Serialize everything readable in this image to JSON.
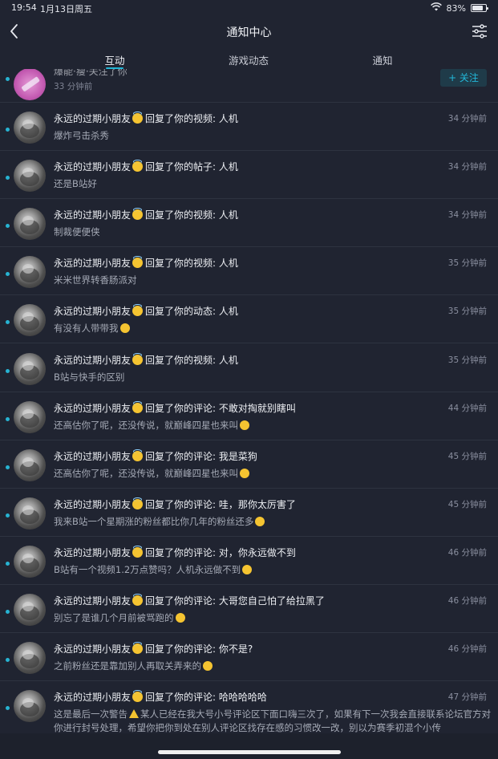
{
  "status": {
    "time": "19:54",
    "date": "1月13日周五",
    "battery": "83%",
    "battery_level": 0.83
  },
  "nav": {
    "title": "通知中心"
  },
  "tabs": [
    {
      "label": "互动",
      "active": true
    },
    {
      "label": "游戏动态",
      "active": false
    },
    {
      "label": "通知",
      "active": false
    }
  ],
  "first_item": {
    "name_partial": "爆能·瘦·关注了你",
    "time": "33 分钟前",
    "follow_label": "+ 关注"
  },
  "items": [
    {
      "name": "永远的过期小朋友",
      "action": "回复了你的视频: 人机",
      "content": "爆炸弓击杀秀",
      "time": "34 分钟前",
      "emoji": false
    },
    {
      "name": "永远的过期小朋友",
      "action": "回复了你的帖子: 人机",
      "content": "还是B站好",
      "time": "34 分钟前",
      "emoji": false
    },
    {
      "name": "永远的过期小朋友",
      "action": "回复了你的视频: 人机",
      "content": "制裁便便侠",
      "time": "34 分钟前",
      "emoji": false
    },
    {
      "name": "永远的过期小朋友",
      "action": "回复了你的视频: 人机",
      "content": "米米世界转香肠派对",
      "time": "35 分钟前",
      "emoji": false
    },
    {
      "name": "永远的过期小朋友",
      "action": "回复了你的动态: 人机",
      "content": "有没有人带带我",
      "time": "35 分钟前",
      "emoji": true
    },
    {
      "name": "永远的过期小朋友",
      "action": "回复了你的视频: 人机",
      "content": "B站与快手的区别",
      "time": "35 分钟前",
      "emoji": false
    },
    {
      "name": "永远的过期小朋友",
      "action": "回复了你的评论: 不敢对掏就别瞎叫",
      "content": "还高估你了呢，还没传说，就巅峰四星也来叫",
      "time": "44 分钟前",
      "emoji": true
    },
    {
      "name": "永远的过期小朋友",
      "action": "回复了你的评论: 我是菜狗",
      "content": "还高估你了呢，还没传说，就巅峰四星也来叫",
      "time": "45 分钟前",
      "emoji": true
    },
    {
      "name": "永远的过期小朋友",
      "action": "回复了你的评论: 哇，那你太厉害了",
      "content": "我来B站一个星期涨的粉丝都比你几年的粉丝还多",
      "time": "45 分钟前",
      "emoji": true
    },
    {
      "name": "永远的过期小朋友",
      "action": "回复了你的评论: 对，你永远做不到",
      "content": "B站有一个视频1.2万点赞吗？人机永远做不到",
      "time": "46 分钟前",
      "emoji": true
    },
    {
      "name": "永远的过期小朋友",
      "action": "回复了你的评论: 大哥您自己怕了给拉黑了",
      "content": "别忘了是谁几个月前被骂跑的",
      "time": "46 分钟前",
      "emoji": true
    },
    {
      "name": "永远的过期小朋友",
      "action": "回复了你的评论: 你不是?",
      "content": "之前粉丝还是靠加别人再取关弄来的",
      "time": "46 分钟前",
      "emoji": true
    }
  ],
  "last_item": {
    "name": "永远的过期小朋友",
    "action": "回复了你的评论: 哈哈哈哈哈",
    "content_a": "这是最后一次警告",
    "content_b": "某人已经在我大号小号评论区下面口嗨三次了，如果有下一次我会直接联系论坛官方对你进行封号处理，希望你把你到处在别人评论区找存在感的习惯改一改，别以为赛季初混个小传",
    "time": "47 分钟前"
  },
  "colors": {
    "accent": "#21b6d6",
    "background": "#202431"
  }
}
